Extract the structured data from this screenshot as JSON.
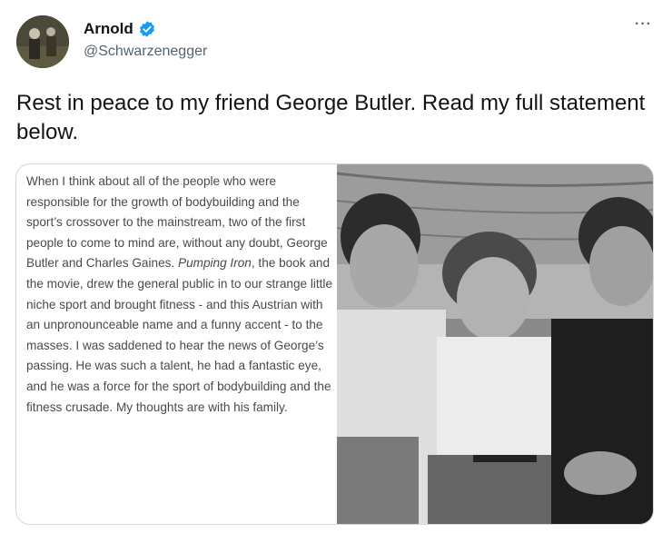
{
  "author": {
    "display_name": "Arnold",
    "handle": "@Schwarzenegger",
    "verified_icon": "verified-badge-icon",
    "accent_color": "#1d9bf0"
  },
  "tweet": {
    "text": "Rest in peace to my friend George Butler. Read my full statement below."
  },
  "more_menu": {
    "label": "···",
    "icon": "more-options-icon"
  },
  "statement": {
    "part1": "When I think about all of the people who were responsible for the growth of bodybuilding and the sport’s crossover to the mainstream, two of the first people to come to mind are, without any doubt, George Butler and Charles Gaines. ",
    "italic_title": "Pumping Iron",
    "part2": ", the book and the movie, drew the general public in to our strange little niche sport and brought fitness - and this Austrian with an unpronounceable name and a funny accent - to the masses. I was saddened to hear the news of George’s passing. He was such a talent, he had a fantastic eye, and he was a force for the sport of bodybuilding and the fitness crusade. My thoughts are with his family."
  }
}
